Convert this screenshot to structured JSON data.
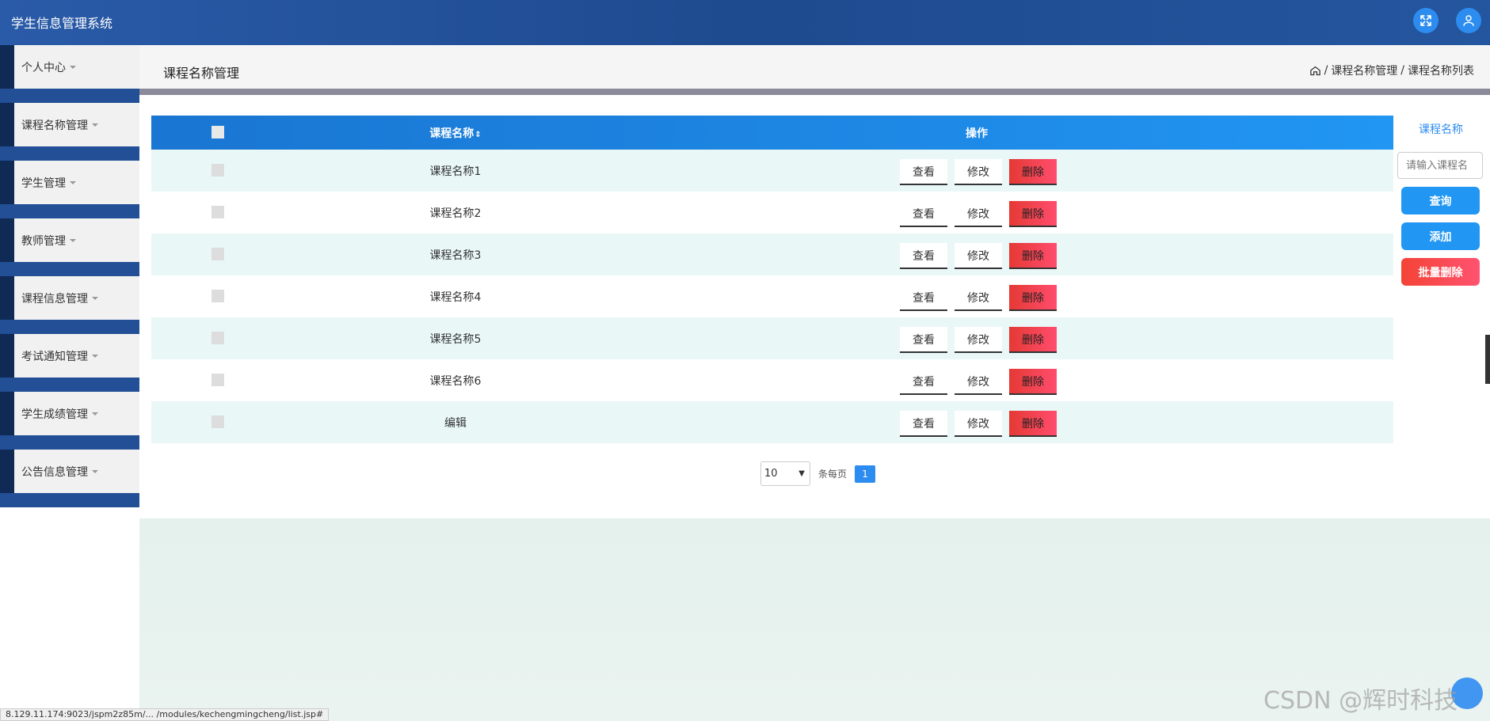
{
  "app": {
    "title": "学生信息管理系统"
  },
  "topbar": {
    "fullscreen_icon": "expand-arrows-icon",
    "user_icon": "user-icon"
  },
  "sidebar": {
    "items": [
      {
        "label": "个人中心",
        "has_caret": true
      },
      {
        "label": "课程名称管理",
        "has_caret": true
      },
      {
        "label": "学生管理",
        "has_caret": true
      },
      {
        "label": "教师管理",
        "has_caret": true
      },
      {
        "label": "课程信息管理",
        "has_caret": true
      },
      {
        "label": "考试通知管理",
        "has_caret": true
      },
      {
        "label": "学生成绩管理",
        "has_caret": true
      },
      {
        "label": "公告信息管理",
        "has_caret": true
      }
    ]
  },
  "header": {
    "title": "课程名称管理",
    "breadcrumb": {
      "home_icon": "home-icon",
      "sep": "/",
      "level1": "课程名称管理",
      "level2": "课程名称列表"
    }
  },
  "table": {
    "columns": {
      "name": "课程名称",
      "sort_icon": "⇕",
      "actions": "操作"
    },
    "rows": [
      {
        "name": "课程名称1"
      },
      {
        "name": "课程名称2"
      },
      {
        "name": "课程名称3"
      },
      {
        "name": "课程名称4"
      },
      {
        "name": "课程名称5"
      },
      {
        "name": "课程名称6"
      },
      {
        "name": "编辑"
      }
    ],
    "actions": {
      "view": "查看",
      "edit": "修改",
      "delete": "删除"
    }
  },
  "pagination": {
    "page_size": "10",
    "per_page_label": "条每页",
    "current_page": "1"
  },
  "search": {
    "label": "课程名称",
    "placeholder": "请输入课程名",
    "query_button": "查询",
    "add_button": "添加",
    "batch_delete_button": "批量删除"
  },
  "statusbar": {
    "url": "8.129.11.174:9023/jspm2z85m/... /modules/kechengmingcheng/list.jsp#"
  },
  "watermark": {
    "text": "CSDN @辉时科技"
  },
  "colors": {
    "topbar": "#1e4a8f",
    "table_header": "#1e88e5",
    "primary": "#2196f3",
    "danger": "#f44336",
    "row_odd": "#e9f7f7"
  }
}
